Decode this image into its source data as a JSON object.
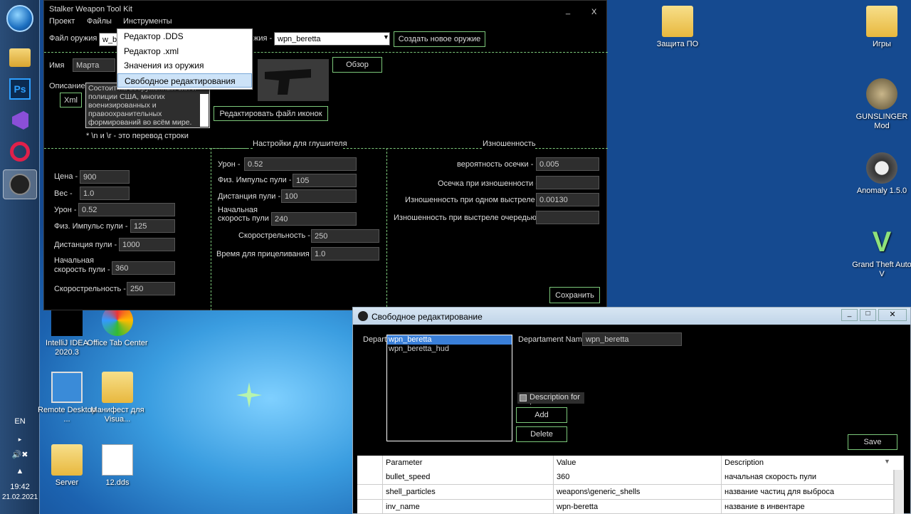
{
  "desktop": {
    "icons": [
      {
        "label": "Защита ПО"
      },
      {
        "label": "Игры"
      },
      {
        "label": "GUNSLINGER Mod"
      },
      {
        "label": "Anomaly 1.5.0"
      },
      {
        "label": "Grand Theft Auto V"
      },
      {
        "label": "IntelliJ IDEA 2020.3"
      },
      {
        "label": "Office Tab Center"
      },
      {
        "label": "Remote Desktop ..."
      },
      {
        "label": "Манифест для Visua..."
      },
      {
        "label": "Server"
      },
      {
        "label": "12.dds"
      }
    ]
  },
  "taskbar": {
    "lang": "EN",
    "time": "19:42",
    "date": "21.02.2021"
  },
  "main": {
    "title": "Stalker Weapon Tool Kit",
    "minimize": "_",
    "close": "X",
    "menu": [
      "Проект",
      "Файлы",
      "Инструменты"
    ],
    "weapon_file_label": "Файл оружия",
    "weapon_file_value": "w_be",
    "weapon_label_right": "жия -",
    "weapon_select": "wpn_beretta",
    "create_btn": "Создать новое оружие",
    "name_label": "Имя",
    "name_value": "Марта",
    "browse_btn": "Обзор",
    "desc_label": "Описание",
    "xml_btn": "Xml",
    "description": "Состоит на вооружённых сил и полиции США, многих военизированных и правоохранительных формирований во всём мире.",
    "edit_icons_btn": "Редактировать файл иконок",
    "hint": "* \\n и \\r - это перевод строки",
    "sec_silencer": "Настройки для глушителя",
    "sec_wear": "Изношенность",
    "left": [
      {
        "label": "Цена -",
        "value": "900"
      },
      {
        "label": "Вес -",
        "value": "1.0"
      },
      {
        "label": "Урон -",
        "value": "0.52"
      },
      {
        "label": "Физ. Импульс пули -",
        "value": "125"
      },
      {
        "label": "Дистанция пули -",
        "value": "1000"
      },
      {
        "label": "Начальная скорость пули -",
        "value": "360"
      },
      {
        "label": "Скорострельность -",
        "value": "250"
      }
    ],
    "mid": [
      {
        "label": "Урон -",
        "value": "0.52"
      },
      {
        "label": "Физ. Импульс пули -",
        "value": "105"
      },
      {
        "label": "Дистанция пули -",
        "value": "100"
      },
      {
        "label": "Начальная скорость пули -",
        "value": "240"
      },
      {
        "label": "Скорострельность -",
        "value": "250"
      },
      {
        "label": "Время для прицеливания -",
        "value": "1.0"
      }
    ],
    "right": [
      {
        "label": "вероятность осечки -",
        "value": "0.005"
      },
      {
        "label": "Осечка при изношенности -",
        "value": ""
      },
      {
        "label": "Изношенность при одном выстреле -",
        "value": "0.00130"
      },
      {
        "label": "Изношенность при выстреле очередью -",
        "value": ""
      }
    ],
    "save_btn": "Сохранить"
  },
  "dropdown": [
    "Редактор .DDS",
    "Редактор .xml",
    "Значения из оружия",
    "Свободное редактирования"
  ],
  "free_edit": {
    "title": "Свободное редактирование",
    "depart_label": "Departa",
    "list": [
      "wpn_beretta",
      "wpn_beretta_hud"
    ],
    "depart_name_label": "Departament Name-",
    "depart_name_value": "wpn_beretta",
    "desc_for": "Description for ;",
    "add_btn": "Add",
    "delete_btn": "Delete",
    "save_btn": "Save",
    "columns": [
      "Parameter",
      "Value",
      "Description"
    ],
    "rows": [
      {
        "p": "bullet_speed",
        "v": "360",
        "d": "начальная скорость пули"
      },
      {
        "p": "shell_particles",
        "v": "weapons\\generic_shells",
        "d": "название частиц для выброса"
      },
      {
        "p": "inv_name",
        "v": "wpn-beretta",
        "d": "название в инвентаре"
      }
    ]
  }
}
